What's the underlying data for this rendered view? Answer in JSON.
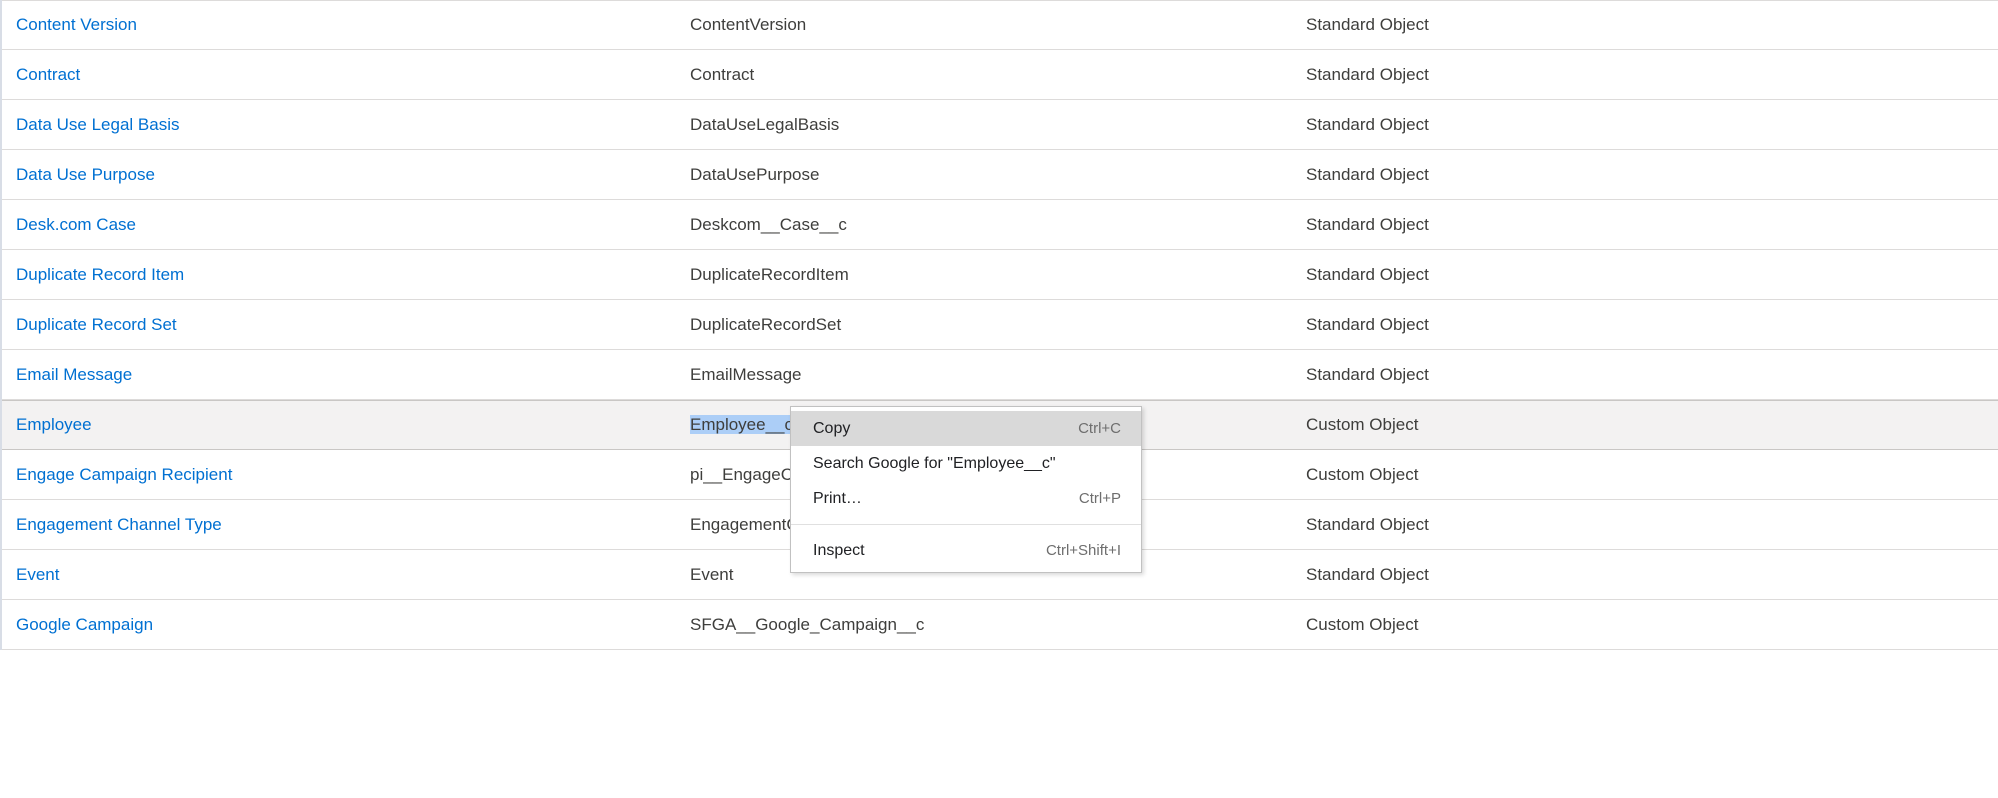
{
  "rows": [
    {
      "label": "Content Version",
      "api": "ContentVersion",
      "type": "Standard Object",
      "highlighted": false
    },
    {
      "label": "Contract",
      "api": "Contract",
      "type": "Standard Object",
      "highlighted": false
    },
    {
      "label": "Data Use Legal Basis",
      "api": "DataUseLegalBasis",
      "type": "Standard Object",
      "highlighted": false
    },
    {
      "label": "Data Use Purpose",
      "api": "DataUsePurpose",
      "type": "Standard Object",
      "highlighted": false
    },
    {
      "label": "Desk.com Case",
      "api": "Deskcom__Case__c",
      "type": "Standard Object",
      "highlighted": false
    },
    {
      "label": "Duplicate Record Item",
      "api": "DuplicateRecordItem",
      "type": "Standard Object",
      "highlighted": false
    },
    {
      "label": "Duplicate Record Set",
      "api": "DuplicateRecordSet",
      "type": "Standard Object",
      "highlighted": false
    },
    {
      "label": "Email Message",
      "api": "EmailMessage",
      "type": "Standard Object",
      "highlighted": false
    },
    {
      "label": "Employee",
      "api": "Employee__c",
      "type": "Custom Object",
      "highlighted": true,
      "selected": true
    },
    {
      "label": "Engage Campaign Recipient",
      "api": "pi__EngageCampaignRecipient__c",
      "type": "Custom Object",
      "highlighted": false
    },
    {
      "label": "Engagement Channel Type",
      "api": "EngagementChannelType",
      "type": "Standard Object",
      "highlighted": false
    },
    {
      "label": "Event",
      "api": "Event",
      "type": "Standard Object",
      "highlighted": false
    },
    {
      "label": "Google Campaign",
      "api": "SFGA__Google_Campaign__c",
      "type": "Custom Object",
      "highlighted": false
    }
  ],
  "context_menu": {
    "items": [
      {
        "label": "Copy",
        "shortcut": "Ctrl+C",
        "hover": true
      },
      {
        "label": "Search Google for \"Employee__c\"",
        "shortcut": "",
        "hover": false
      },
      {
        "label": "Print…",
        "shortcut": "Ctrl+P",
        "hover": false
      }
    ],
    "inspect": {
      "label": "Inspect",
      "shortcut": "Ctrl+Shift+I"
    }
  }
}
